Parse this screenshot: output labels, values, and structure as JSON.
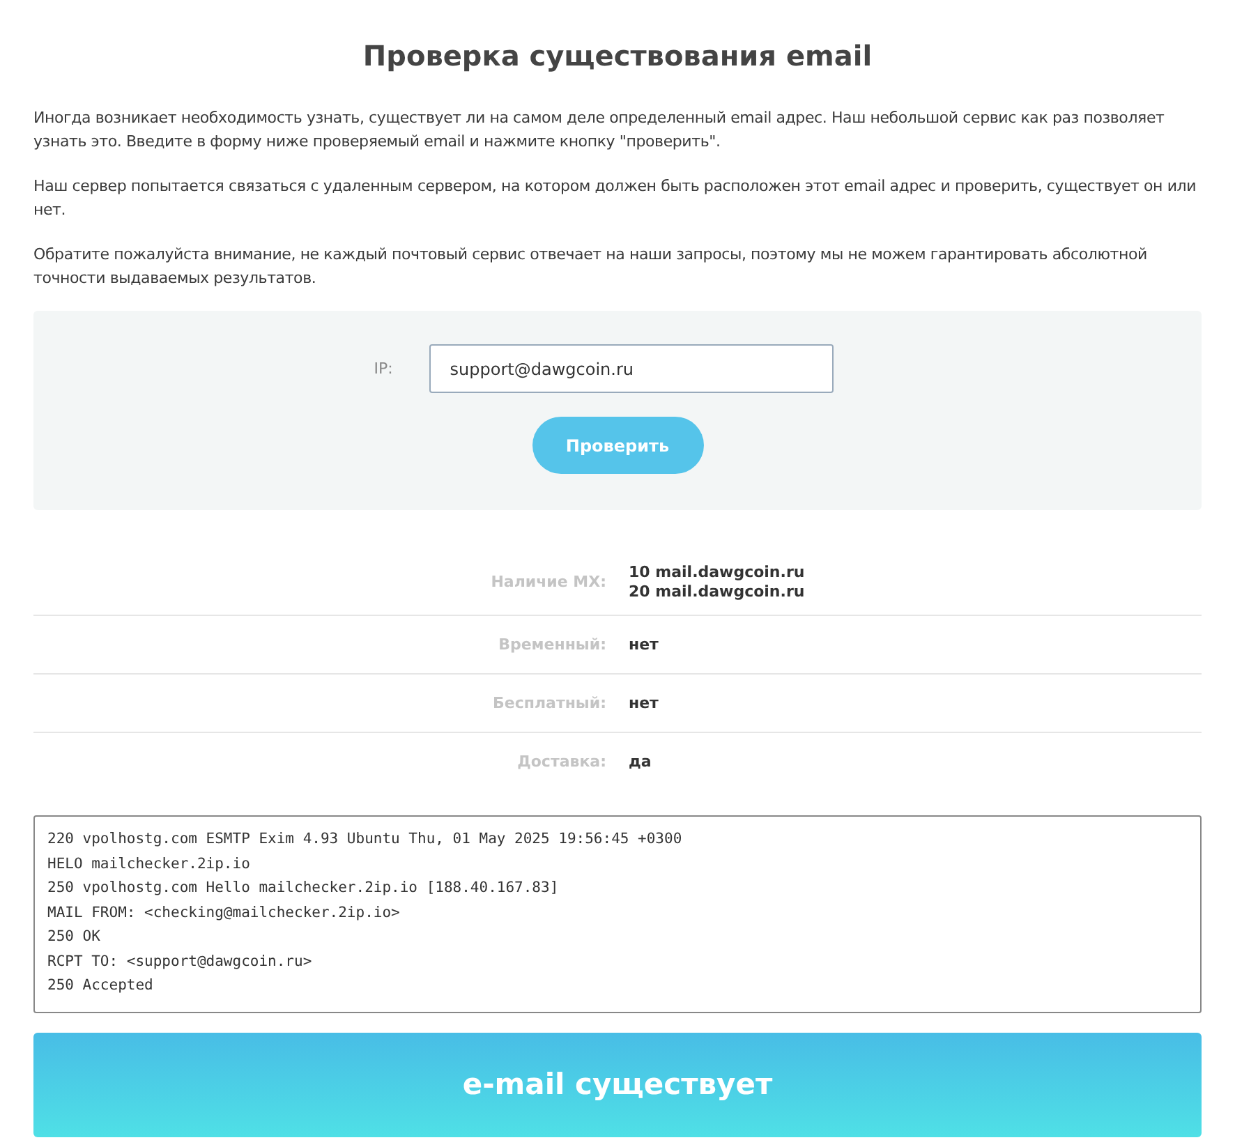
{
  "title": "Проверка существования email",
  "paragraphs": [
    "Иногда возникает необходимость узнать, существует ли на самом деле определенный email адрес. Наш небольшой сервис как раз позволяет узнать это. Введите в форму ниже проверяемый email и нажмите кнопку \"проверить\".",
    "Наш сервер попытается связаться с удаленным сервером, на котором должен быть расположен этот email адрес и проверить, существует он или нет.",
    "Обратите пожалуйста внимание, не каждый почтовый сервис отвечает на наши запросы, поэтому мы не можем гарантировать абсолютной точности выдаваемых результатов."
  ],
  "form": {
    "label": "IP:",
    "value": "support@dawgcoin.ru",
    "button": "Проверить"
  },
  "results": [
    {
      "label": "Наличие MX:",
      "values": [
        "**10** mail.dawgcoin.ru",
        "**20** mail.dawgcoin.ru"
      ]
    },
    {
      "label": "Временный:",
      "values": [
        "нет"
      ]
    },
    {
      "label": "Бесплатный:",
      "values": [
        "нет"
      ]
    },
    {
      "label": "Доставка:",
      "values": [
        "да"
      ]
    }
  ],
  "log": [
    "220 vpolhostg.com ESMTP Exim 4.93 Ubuntu Thu, 01 May 2025 19:56:45 +0300",
    "HELO mailchecker.2ip.io",
    "250 vpolhostg.com Hello mailchecker.2ip.io [188.40.167.83]",
    "MAIL FROM: <checking@mailchecker.2ip.io>",
    "250 OK",
    "RCPT TO: <support@dawgcoin.ru>",
    "250 Accepted"
  ],
  "verdict": {
    "kind": "success",
    "text": "e-mail существует"
  }
}
